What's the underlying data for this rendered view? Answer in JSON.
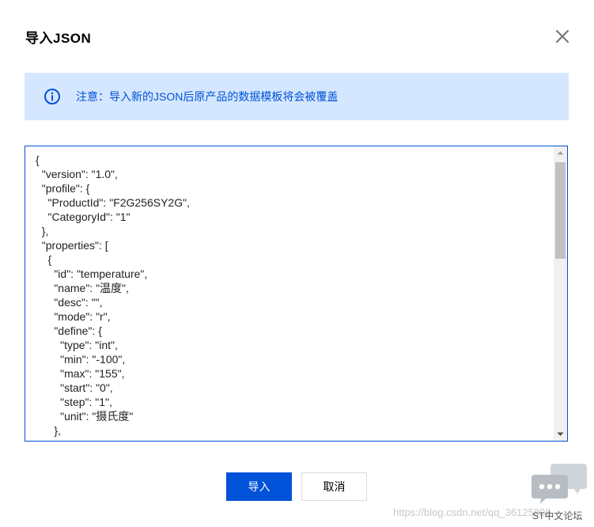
{
  "dialog": {
    "title": "导入JSON",
    "close_icon": "close-icon"
  },
  "alert": {
    "icon": "info-icon",
    "text": "注意：导入新的JSON后原产品的数据模板将会被覆盖"
  },
  "editor": {
    "content": "{\n  \"version\": \"1.0\",\n  \"profile\": {\n    \"ProductId\": \"F2G256SY2G\",\n    \"CategoryId\": \"1\"\n  },\n  \"properties\": [\n    {\n      \"id\": \"temperature\",\n      \"name\": \"温度\",\n      \"desc\": \"\",\n      \"mode\": \"r\",\n      \"define\": {\n        \"type\": \"int\",\n        \"min\": \"-100\",\n        \"max\": \"155\",\n        \"start\": \"0\",\n        \"step\": \"1\",\n        \"unit\": \"摄氏度\"\n      },\n      \"required\": false"
  },
  "buttons": {
    "confirm_label": "导入",
    "cancel_label": "取消"
  },
  "watermark": {
    "url": "https://blog.csdn.net/qq_36125808",
    "forum": "ST中文论坛"
  },
  "colors": {
    "primary": "#0052d9",
    "alert_bg": "#d5e7ff"
  }
}
